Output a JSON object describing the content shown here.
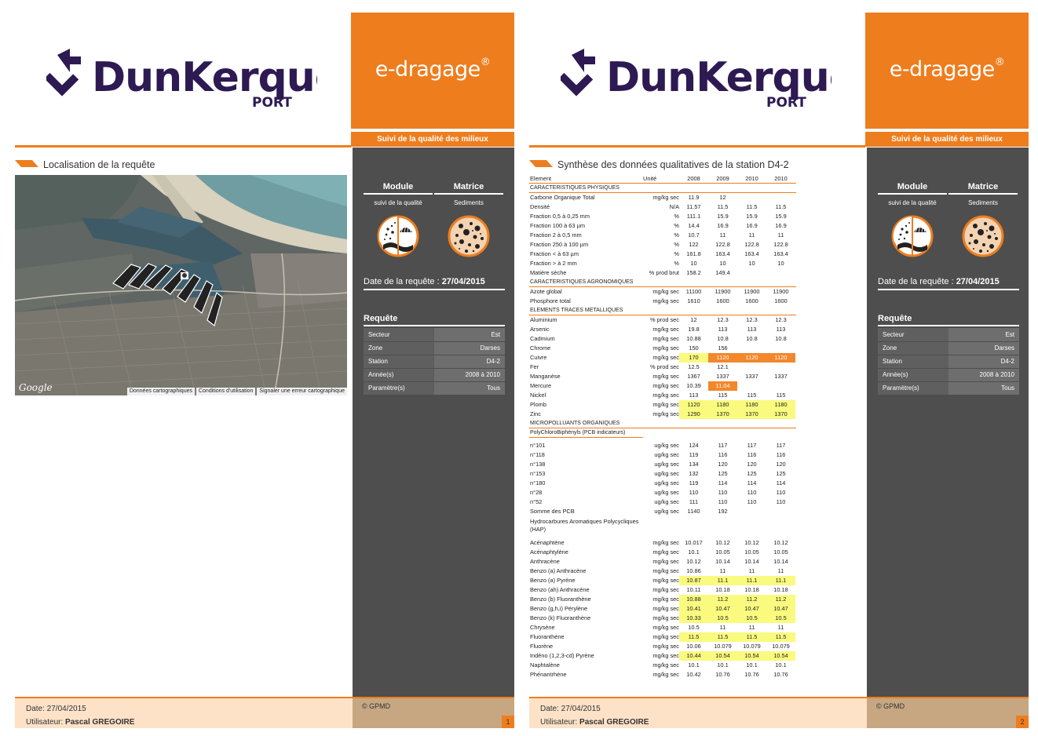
{
  "brand": {
    "logo_text": "DunKerque",
    "logo_sub": "PORT",
    "product": "e-dragage",
    "registered": "®",
    "subtitle": "Suivi de la qualité des milieux"
  },
  "sidebar": {
    "module_label": "Module",
    "matrice_label": "Matrice",
    "module_value": "suivi de la qualité",
    "matrice_value": "Sediments",
    "date_label": "Date de la requête :",
    "date_value": "27/04/2015",
    "requete_title": "Requête",
    "params": [
      {
        "k": "Secteur",
        "v": "Est"
      },
      {
        "k": "Zone",
        "v": "Darses"
      },
      {
        "k": "Station",
        "v": "D4-2"
      },
      {
        "k": "Année(s)",
        "v": "2008 à 2010"
      },
      {
        "k": "Paramètre(s)",
        "v": "Tous"
      }
    ]
  },
  "footer": {
    "date": "Date: 27/04/2015",
    "user_label": "Utilisateur:",
    "user_name": "Pascal GREGOIRE",
    "copyright": "© GPMD"
  },
  "page1": {
    "title": "Localisation de la requête",
    "page_number": "1",
    "map_logo": "Google",
    "map_credits": [
      "Données cartographiques",
      "Conditions d'utilisation",
      "Signaler une erreur cartographique"
    ]
  },
  "page2": {
    "title": "Synthèse des données qualitatives de la station D4-2",
    "page_number": "2",
    "table": {
      "header": {
        "element": "Element",
        "unit": "Unité",
        "years": [
          "2008",
          "2009",
          "2010",
          "2010"
        ]
      },
      "rows": [
        {
          "type": "cat",
          "label": "CARACTERISTIQUES PHYSIQUES"
        },
        {
          "label": "Carbone Organique Total",
          "unit": "mg/kg sec",
          "v": [
            "11.9",
            "12",
            "",
            ""
          ]
        },
        {
          "label": "Densité",
          "unit": "N/A",
          "v": [
            "11.57",
            "11.5",
            "11.5",
            "11.5"
          ]
        },
        {
          "label": "Fraction 0,5 à 0,25 mm",
          "unit": "%",
          "v": [
            "111.1",
            "15.9",
            "15.9",
            "15.9"
          ]
        },
        {
          "label": "Fraction 100 à 63 µm",
          "unit": "%",
          "v": [
            "14.4",
            "16.9",
            "16.9",
            "16.9"
          ]
        },
        {
          "label": "Fraction 2 à 0,5 mm",
          "unit": "%",
          "v": [
            "10.7",
            "11",
            "11",
            "11"
          ]
        },
        {
          "label": "Fraction 250 à 100 µm",
          "unit": "%",
          "v": [
            "122",
            "122.8",
            "122.8",
            "122.8"
          ]
        },
        {
          "label": "Fraction < à 63 µm",
          "unit": "%",
          "v": [
            "161.8",
            "163.4",
            "163.4",
            "163.4"
          ]
        },
        {
          "label": "Fraction > à 2 mm",
          "unit": "%",
          "v": [
            "10",
            "10",
            "10",
            "10"
          ]
        },
        {
          "label": "Matière sèche",
          "unit": "% prod brut",
          "v": [
            "158.2",
            "149.4",
            "",
            ""
          ]
        },
        {
          "type": "cat",
          "label": "CARACTERISTIQUES AGRONOMIQUES"
        },
        {
          "label": "Azote global",
          "unit": "mg/kg sec",
          "v": [
            "11100",
            "11900",
            "11900",
            "11900"
          ]
        },
        {
          "label": "Phosphore total",
          "unit": "mg/kg sec",
          "v": [
            "1610",
            "1600",
            "1600",
            "1600"
          ]
        },
        {
          "type": "cat",
          "label": "ELEMENTS TRACES METALLIQUES"
        },
        {
          "label": "Aluminium",
          "unit": "% prod sec",
          "v": [
            "12",
            "12.3",
            "12.3",
            "12.3"
          ]
        },
        {
          "label": "Arsenic",
          "unit": "mg/kg sec",
          "v": [
            "19.8",
            "113",
            "113",
            "113"
          ]
        },
        {
          "label": "Cadmium",
          "unit": "mg/kg sec",
          "v": [
            "10.88",
            "10.8",
            "10.8",
            "10.8"
          ]
        },
        {
          "label": "Chrome",
          "unit": "mg/kg sec",
          "v": [
            "150",
            "156",
            "",
            ""
          ]
        },
        {
          "label": "Cuivre",
          "unit": "mg/kg sec",
          "v": [
            "170",
            "1120",
            "1120",
            "1120"
          ],
          "hl": [
            "y",
            "o",
            "o",
            "o"
          ]
        },
        {
          "label": "Fer",
          "unit": "% prod sec",
          "v": [
            "12.5",
            "12.1",
            "",
            ""
          ]
        },
        {
          "label": "Manganèse",
          "unit": "mg/kg sec",
          "v": [
            "1367",
            "1337",
            "1337",
            "1337"
          ]
        },
        {
          "label": "Mercure",
          "unit": "mg/kg sec",
          "v": [
            "10.39",
            "11.04",
            "",
            ""
          ],
          "hl": [
            "",
            "o",
            "",
            ""
          ]
        },
        {
          "label": "Nickel",
          "unit": "mg/kg sec",
          "v": [
            "113",
            "115",
            "115",
            "115"
          ]
        },
        {
          "label": "Plomb",
          "unit": "mg/kg sec",
          "v": [
            "1120",
            "1180",
            "1180",
            "1180"
          ],
          "hl": [
            "y",
            "y",
            "y",
            "y"
          ]
        },
        {
          "label": "Zinc",
          "unit": "mg/kg sec",
          "v": [
            "1290",
            "1370",
            "1370",
            "1370"
          ],
          "hl": [
            "y",
            "y",
            "y",
            "y"
          ]
        },
        {
          "type": "cat",
          "label": "MICROPOLLUANTS ORGANIQUES"
        },
        {
          "type": "subcat",
          "label": "PolyChloroBiphényls (PCB indicateurs)"
        },
        {
          "type": "gap"
        },
        {
          "label": "n°101",
          "unit": "ug/kg sec",
          "v": [
            "124",
            "117",
            "117",
            "117"
          ]
        },
        {
          "label": "n°118",
          "unit": "ug/kg sec",
          "v": [
            "119",
            "116",
            "116",
            "116"
          ]
        },
        {
          "label": "n°138",
          "unit": "ug/kg sec",
          "v": [
            "134",
            "120",
            "120",
            "120"
          ]
        },
        {
          "label": "n°153",
          "unit": "ug/kg sec",
          "v": [
            "132",
            "125",
            "125",
            "125"
          ]
        },
        {
          "label": "n°180",
          "unit": "ug/kg sec",
          "v": [
            "119",
            "114",
            "114",
            "114"
          ]
        },
        {
          "label": "n°28",
          "unit": "ug/kg sec",
          "v": [
            "110",
            "110",
            "110",
            "110"
          ]
        },
        {
          "label": "n°52",
          "unit": "ug/kg sec",
          "v": [
            "111",
            "110",
            "110",
            "110"
          ]
        },
        {
          "label": "Somme des PCB",
          "unit": "ug/kg sec",
          "v": [
            "1140",
            "192",
            "",
            ""
          ]
        },
        {
          "type": "two",
          "label": "Hydrocarbures Aromatiques Polycycliques (HAP)"
        },
        {
          "type": "gap"
        },
        {
          "label": "Acénaphtène",
          "unit": "mg/kg sec",
          "v": [
            "10.017",
            "10.12",
            "10.12",
            "10.12"
          ]
        },
        {
          "label": "Acénaphtylène",
          "unit": "mg/kg sec",
          "v": [
            "10.1",
            "10.05",
            "10.05",
            "10.05"
          ]
        },
        {
          "label": "Anthracène",
          "unit": "mg/kg sec",
          "v": [
            "10.12",
            "10.14",
            "10.14",
            "10.14"
          ]
        },
        {
          "label": "Benzo (a) Anthracène",
          "unit": "mg/kg sec",
          "v": [
            "10.86",
            "11",
            "11",
            "11"
          ]
        },
        {
          "label": "Benzo (a) Pyrène",
          "unit": "mg/kg sec",
          "v": [
            "10.87",
            "11.1",
            "11.1",
            "11.1"
          ],
          "hl": [
            "y",
            "y",
            "y",
            "y"
          ]
        },
        {
          "label": "Benzo (ah) Anthracène",
          "unit": "mg/kg sec",
          "v": [
            "10.11",
            "10.18",
            "10.18",
            "10.18"
          ]
        },
        {
          "label": "Benzo (b) Fluoranthène",
          "unit": "mg/kg sec",
          "v": [
            "10.88",
            "11.2",
            "11.2",
            "11.2"
          ],
          "hl": [
            "y",
            "y",
            "y",
            "y"
          ]
        },
        {
          "label": "Benzo (g,h,i) Pérylène",
          "unit": "mg/kg sec",
          "v": [
            "10.41",
            "10.47",
            "10.47",
            "10.47"
          ],
          "hl": [
            "y",
            "y",
            "y",
            "y"
          ]
        },
        {
          "label": "Benzo (k) Fluoranthène",
          "unit": "mg/kg sec",
          "v": [
            "10.33",
            "10.5",
            "10.5",
            "10.5"
          ],
          "hl": [
            "y",
            "y",
            "y",
            "y"
          ]
        },
        {
          "label": "Chrysène",
          "unit": "mg/kg sec",
          "v": [
            "10.5",
            "11",
            "11",
            "11"
          ]
        },
        {
          "label": "Fluoranthène",
          "unit": "mg/kg sec",
          "v": [
            "11.5",
            "11.5",
            "11.5",
            "11.5"
          ],
          "hl": [
            "y",
            "y",
            "y",
            "y"
          ]
        },
        {
          "label": "Fluorène",
          "unit": "mg/kg sec",
          "v": [
            "10.06",
            "10.079",
            "10.079",
            "10.079"
          ]
        },
        {
          "label": "Indéno (1,2,3-cd) Pyrène",
          "unit": "mg/kg sec",
          "v": [
            "10.44",
            "10.54",
            "10.54",
            "10.54"
          ],
          "hl": [
            "y",
            "y",
            "y",
            "y"
          ]
        },
        {
          "label": "Naphtalène",
          "unit": "mg/kg sec",
          "v": [
            "10.1",
            "10.1",
            "10.1",
            "10.1"
          ]
        },
        {
          "label": "Phénantrhène",
          "unit": "mg/kg sec",
          "v": [
            "10.42",
            "10.76",
            "10.76",
            "10.76"
          ]
        }
      ]
    }
  },
  "colors": {
    "accent": "#ee7d1e",
    "sidebar": "#4e4e4e",
    "highlight_yellow": "#fafa7f",
    "highlight_orange": "#f2872c",
    "logo": "#2d1a52"
  }
}
